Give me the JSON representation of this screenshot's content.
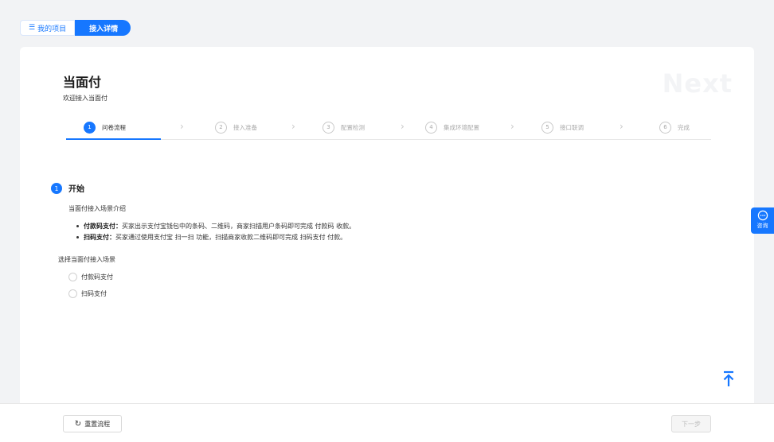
{
  "topnav": {
    "my_projects": "我的项目",
    "access_details": "接入详情"
  },
  "header": {
    "title": "当面付",
    "subtitle": "欢迎接入当面付",
    "watermark": "Next"
  },
  "steps": [
    {
      "num": "1",
      "label": "问卷流程",
      "active": true
    },
    {
      "num": "2",
      "label": "接入准备",
      "active": false
    },
    {
      "num": "3",
      "label": "配置检测",
      "active": false
    },
    {
      "num": "4",
      "label": "集成环境配置",
      "active": false
    },
    {
      "num": "5",
      "label": "接口联调",
      "active": false
    },
    {
      "num": "6",
      "label": "完成",
      "active": false
    }
  ],
  "section": {
    "num": "1",
    "title": "开始",
    "intro_label": "当面付接入场景介绍",
    "bullets": [
      {
        "term": "付款码支付：",
        "desc": "买家出示支付宝钱包中的条码、二维码，商家扫描用户条码即可完成 付款码 收款。"
      },
      {
        "term": "扫码支付：",
        "desc": "买家通过使用支付宝 扫一扫 功能，扫描商家收款二维码即可完成 扫码支付 付款。"
      }
    ],
    "select_label": "选择当面付接入场景",
    "options": [
      "付款码支付",
      "扫码支付"
    ]
  },
  "consult": {
    "label": "咨询"
  },
  "footer": {
    "reset_label": "重置流程",
    "next_label": "下一步"
  },
  "colors": {
    "accent": "#1677ff"
  },
  "icons": {
    "list": "list-icon",
    "reset": "refresh-icon",
    "totop": "back-to-top-icon",
    "consult": "chat-bubble-icon"
  }
}
